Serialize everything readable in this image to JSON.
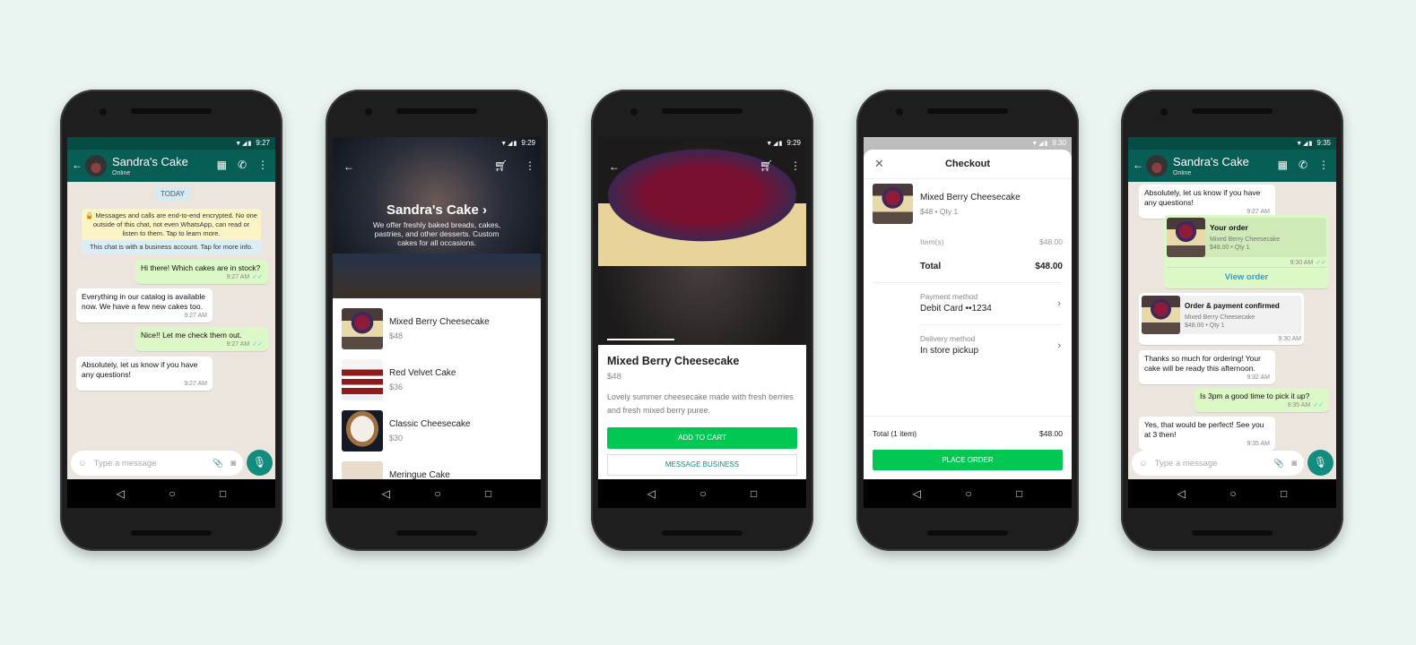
{
  "common": {
    "business_name": "Sandra's Cake",
    "online": "Online",
    "input_placeholder": "Type a message"
  },
  "phone1": {
    "time": "9:27",
    "date_chip": "TODAY",
    "encryption_notice": "🔒 Messages and calls are end-to-end encrypted. No one outside of this chat, not even WhatsApp, can read or listen to them. Tap to learn more.",
    "business_notice": "This chat is with a business account. Tap for more info.",
    "messages": [
      {
        "dir": "out",
        "text": "Hi there! Which cakes are in stock?",
        "time": "9:27 AM"
      },
      {
        "dir": "in",
        "text": "Everything in our catalog is available now. We have a few new cakes too.",
        "time": "9:27 AM"
      },
      {
        "dir": "out",
        "text": "Nice!! Let me check them out.",
        "time": "9:27 AM"
      },
      {
        "dir": "in",
        "text": "Absolutely, let us know if you have any questions!",
        "time": "9:27 AM"
      }
    ]
  },
  "phone2": {
    "time": "9:29",
    "title": "Sandra's Cake ›",
    "description": "We offer freshly baked breads, cakes, pastries, and other desserts. Custom cakes for all occasions.",
    "products": [
      {
        "name": "Mixed Berry Cheesecake",
        "price": "$48"
      },
      {
        "name": "Red Velvet Cake",
        "price": "$36"
      },
      {
        "name": "Classic Cheesecake",
        "price": "$30"
      },
      {
        "name": "Meringue Cake",
        "price": ""
      }
    ]
  },
  "phone3": {
    "time": "9:29",
    "product_name": "Mixed Berry Cheesecake",
    "price": "$48",
    "description": "Lovely summer cheesecake made with fresh berries and fresh mixed berry puree.",
    "add_to_cart": "ADD TO CART",
    "message_business": "MESSAGE BUSINESS"
  },
  "phone4": {
    "time": "9:30",
    "title": "Checkout",
    "item_name": "Mixed Berry Cheesecake",
    "item_meta": "$48 • Qty 1",
    "items_label": "Item(s)",
    "items_value": "$48.00",
    "total_label": "Total",
    "total_value": "$48.00",
    "payment_label": "Payment method",
    "payment_value": "Debit Card ••1234",
    "delivery_label": "Delivery method",
    "delivery_value": "In store pickup",
    "footer_total_label": "Total (1 item)",
    "footer_total_value": "$48.00",
    "place_order": "PLACE ORDER"
  },
  "phone5": {
    "time": "9:35",
    "msg1": {
      "text": "Absolutely, let us know if you have any questions!",
      "time": "9:27 AM"
    },
    "order": {
      "title": "Your order",
      "item": "Mixed Berry Cheesecake",
      "meta": "$48.00 • Qty 1",
      "time": "9:30 AM",
      "view": "View order"
    },
    "confirm": {
      "title": "Order & payment confirmed",
      "item": "Mixed Berry Cheesecake",
      "meta": "$48.00 • Qty 1",
      "time": "9:30 AM"
    },
    "msg2": {
      "text": "Thanks so much for ordering! Your cake will be ready this afternoon.",
      "time": "9:32 AM"
    },
    "msg3": {
      "text": "Is 3pm a good time to pick it up?",
      "time": "9:35 AM"
    },
    "msg4": {
      "text": "Yes, that would be perfect! See you at 3 then!",
      "time": "9:35 AM"
    }
  },
  "colors": {
    "teal": "#075e54",
    "green_button": "#00c853",
    "outgoing": "#dcf8c6",
    "chat_bg": "#ece5dd"
  }
}
